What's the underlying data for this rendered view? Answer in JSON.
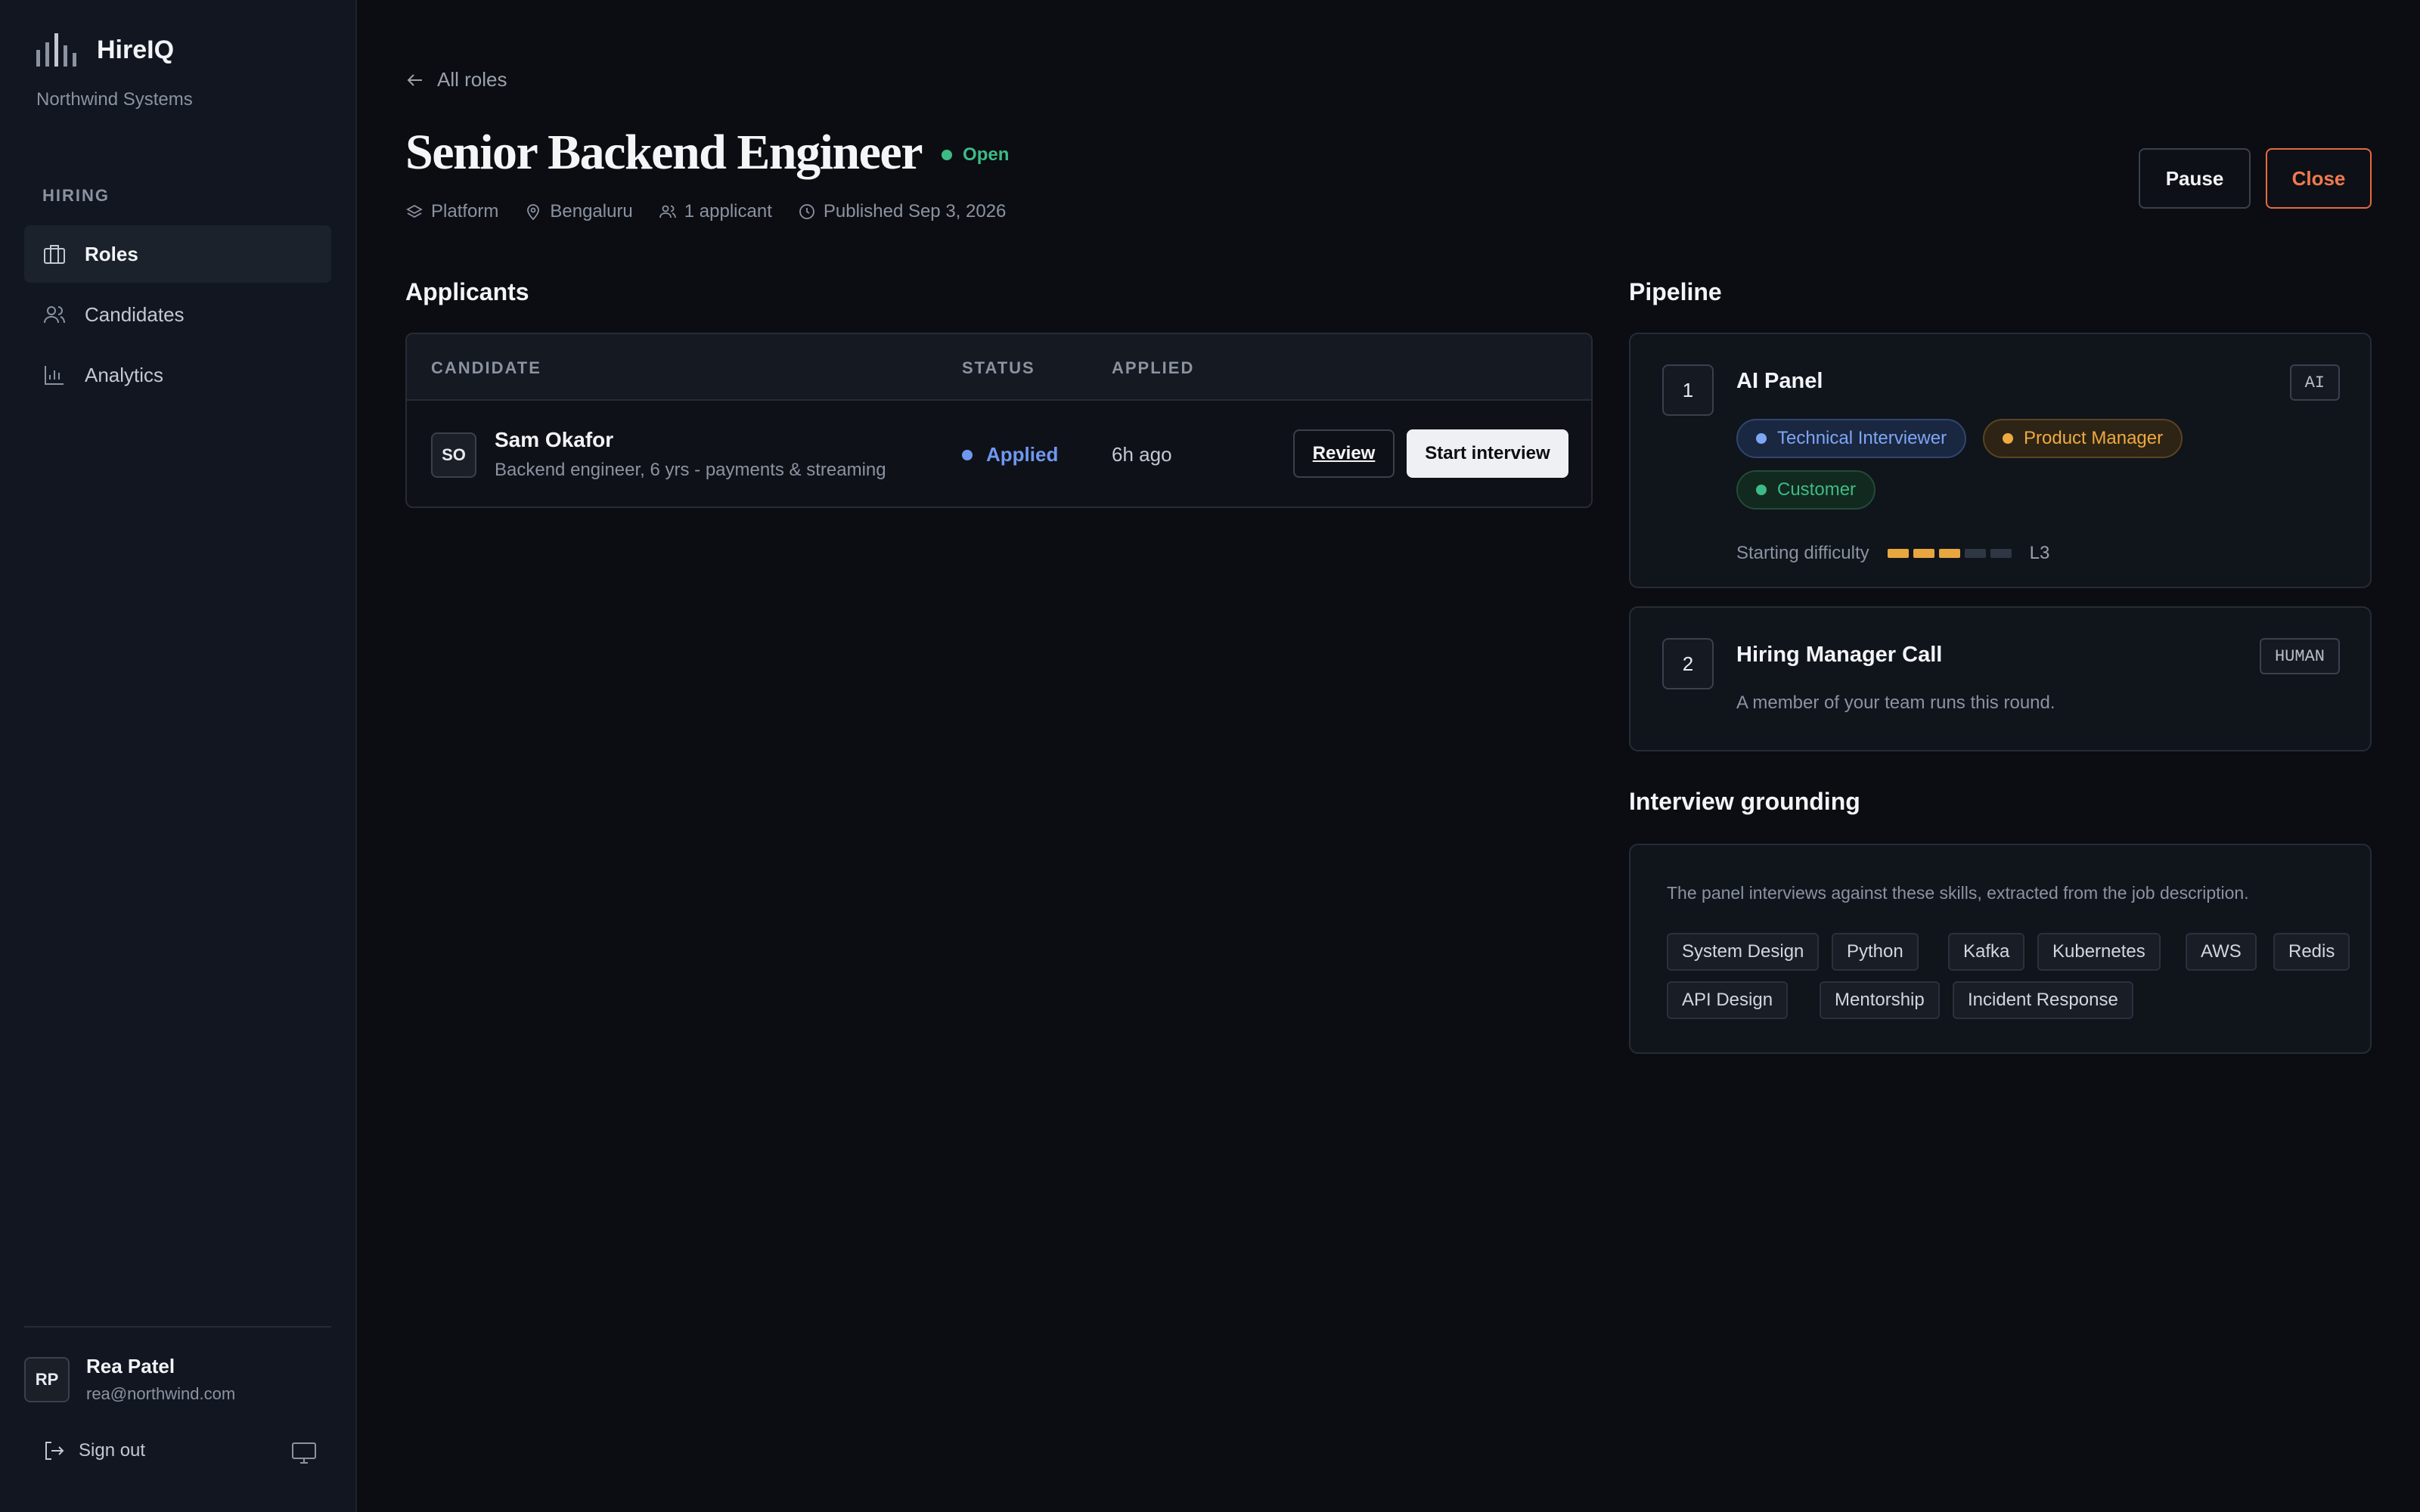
{
  "brand": {
    "name": "HireIQ",
    "org": "Northwind Systems"
  },
  "sidebar": {
    "section_label": "HIRING",
    "items": [
      {
        "label": "Roles",
        "icon": "briefcase-icon",
        "active": true
      },
      {
        "label": "Candidates",
        "icon": "users-icon",
        "active": false
      },
      {
        "label": "Analytics",
        "icon": "bar-chart-icon",
        "active": false
      }
    ],
    "user": {
      "initials": "RP",
      "name": "Rea Patel",
      "email": "rea@northwind.com"
    },
    "sign_out": "Sign out"
  },
  "header": {
    "back_label": "All roles",
    "title": "Senior Backend Engineer",
    "status": "Open",
    "meta": {
      "team": "Platform",
      "location": "Bengaluru",
      "applicants": "1 applicant",
      "published": "Published Sep 3, 2026"
    },
    "actions": {
      "pause": "Pause",
      "close": "Close"
    }
  },
  "applicants": {
    "heading": "Applicants",
    "columns": [
      "CANDIDATE",
      "STATUS",
      "APPLIED"
    ],
    "rows": [
      {
        "initials": "SO",
        "name": "Sam Okafor",
        "summary": "Backend engineer, 6 yrs - payments & streaming",
        "status": "Applied",
        "applied": "6h ago",
        "review_label": "Review",
        "start_label": "Start interview"
      }
    ]
  },
  "pipeline": {
    "heading": "Pipeline",
    "steps": [
      {
        "number": "1",
        "title": "AI Panel",
        "tag": "AI",
        "panelists": [
          "Technical Interviewer",
          "Product Manager",
          "Customer"
        ],
        "difficulty_label": "Starting difficulty",
        "difficulty_level": 3,
        "difficulty_max": 5,
        "difficulty_text": "L3"
      },
      {
        "number": "2",
        "title": "Hiring Manager Call",
        "tag": "HUMAN",
        "description": "A member of your team runs this round."
      }
    ]
  },
  "grounding": {
    "heading": "Interview grounding",
    "description": "The panel interviews against these skills, extracted from the job description.",
    "skills": [
      "System Design",
      "Python",
      "Kafka",
      "Kubernetes",
      "AWS",
      "Redis",
      "API Design",
      "Mentorship",
      "Incident Response"
    ]
  },
  "colors": {
    "accent_open": "#3dbb86",
    "applied_blue": "#6f97f0",
    "close_orange": "#f07a4e",
    "difficulty_on": "#e8a640"
  }
}
